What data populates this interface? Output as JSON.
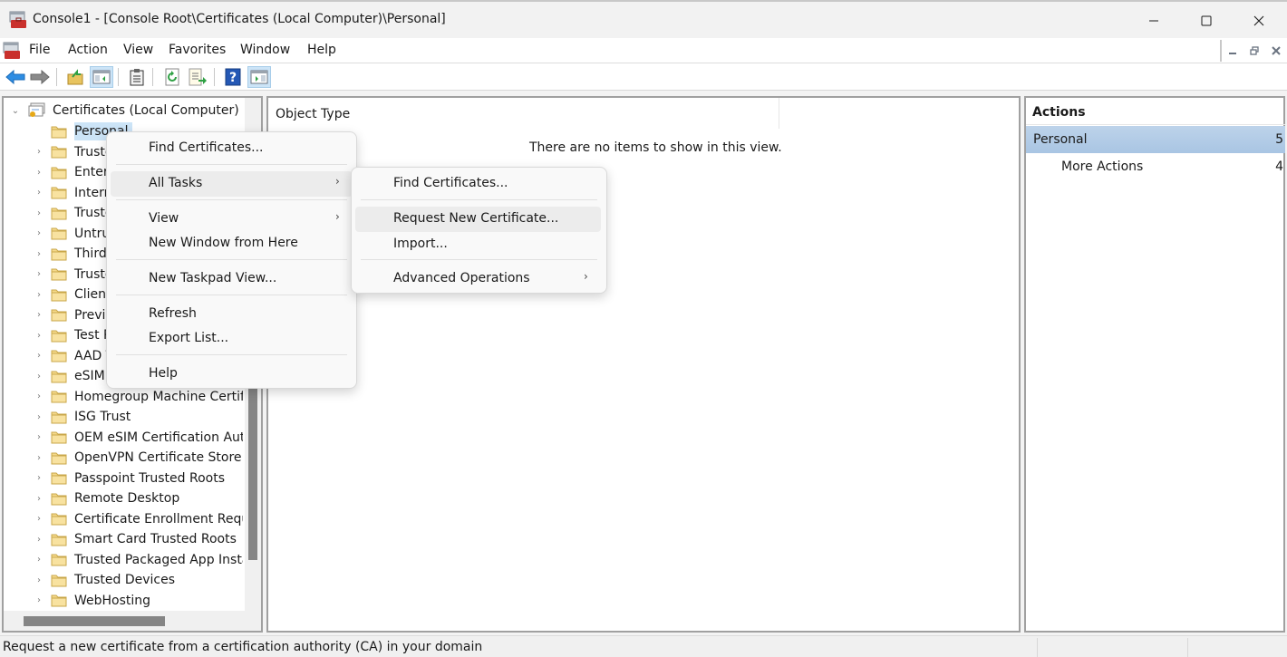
{
  "window": {
    "title": "Console1 - [Console Root\\Certificates (Local Computer)\\Personal]",
    "app_icon": "mmc-toolbox-icon",
    "controls": {
      "minimize": "minimize-icon",
      "maximize": "maximize-icon",
      "close": "close-icon"
    }
  },
  "menubar": {
    "items": [
      "File",
      "Action",
      "View",
      "Favorites",
      "Window",
      "Help"
    ],
    "mdi_controls": [
      "minimize-child-icon",
      "restore-child-icon",
      "close-child-icon"
    ]
  },
  "toolbar": {
    "buttons": [
      {
        "name": "back",
        "icon": "back-arrow-icon"
      },
      {
        "name": "forward",
        "icon": "forward-arrow-icon"
      },
      {
        "name": "up-one-level",
        "icon": "folder-up-icon"
      },
      {
        "name": "show-hide-console-tree",
        "icon": "console-tree-icon",
        "pressed": true
      },
      {
        "name": "properties",
        "icon": "clipboard-icon"
      },
      {
        "name": "refresh",
        "icon": "refresh-icon"
      },
      {
        "name": "export-list",
        "icon": "export-list-icon"
      },
      {
        "name": "help",
        "icon": "help-icon"
      },
      {
        "name": "show-hide-action-pane",
        "icon": "action-pane-icon",
        "pressed": true
      }
    ]
  },
  "tree": {
    "root": {
      "label": "Certificates (Local Computer)",
      "expanded": true
    },
    "items": [
      {
        "label": "Personal",
        "selected": true,
        "expander": false
      },
      {
        "label": "Truste",
        "expander": true
      },
      {
        "label": "Enter",
        "expander": true
      },
      {
        "label": "Intern",
        "expander": true
      },
      {
        "label": "Truste",
        "expander": true
      },
      {
        "label": "Untru",
        "expander": true
      },
      {
        "label": "Third-",
        "expander": true
      },
      {
        "label": "Truste",
        "expander": true
      },
      {
        "label": "Client",
        "expander": true
      },
      {
        "label": "Previe",
        "expander": true
      },
      {
        "label": "Test R",
        "expander": true
      },
      {
        "label": "AAD T",
        "expander": true
      },
      {
        "label": "eSIM",
        "expander": true
      },
      {
        "label": "Homegroup Machine Certific",
        "expander": true
      },
      {
        "label": "ISG Trust",
        "expander": true
      },
      {
        "label": "OEM eSIM Certification Auth",
        "expander": true
      },
      {
        "label": "OpenVPN Certificate Store",
        "expander": true
      },
      {
        "label": "Passpoint Trusted Roots",
        "expander": true
      },
      {
        "label": "Remote Desktop",
        "expander": true
      },
      {
        "label": "Certificate Enrollment Reque",
        "expander": true
      },
      {
        "label": "Smart Card Trusted Roots",
        "expander": true
      },
      {
        "label": "Trusted Packaged App Install",
        "expander": true
      },
      {
        "label": "Trusted Devices",
        "expander": true
      },
      {
        "label": "WebHosting",
        "expander": true
      }
    ]
  },
  "main": {
    "column_header": "Object Type",
    "empty_message": "There are no items to show in this view."
  },
  "actions": {
    "header": "Actions",
    "items": [
      {
        "label": "Personal",
        "glyph": "5",
        "highlighted": true
      },
      {
        "label": "More Actions",
        "glyph": "4",
        "indent": true
      }
    ]
  },
  "context_menu": {
    "items": [
      {
        "label": "Find Certificates..."
      },
      {
        "separator": true
      },
      {
        "label": "All Tasks",
        "submenu": true,
        "hover": true
      },
      {
        "separator": true
      },
      {
        "label": "View",
        "submenu": true
      },
      {
        "label": "New Window from Here"
      },
      {
        "separator": true
      },
      {
        "label": "New Taskpad View..."
      },
      {
        "separator": true
      },
      {
        "label": "Refresh"
      },
      {
        "label": "Export List..."
      },
      {
        "separator": true
      },
      {
        "label": "Help"
      }
    ],
    "submenu_arrow": "›"
  },
  "submenu": {
    "items": [
      {
        "label": "Find Certificates..."
      },
      {
        "separator": true
      },
      {
        "label": "Request New Certificate...",
        "hover": true
      },
      {
        "label": "Import..."
      },
      {
        "separator": true
      },
      {
        "label": "Advanced Operations",
        "submenu": true
      }
    ]
  },
  "statusbar": {
    "message": "Request a new certificate from a certification authority (CA) in your domain"
  },
  "colors": {
    "selection": "#cce4f7",
    "actions_highlight": "#b3cce8",
    "menu_hover": "#ececec",
    "folder": "#f5d98b"
  }
}
